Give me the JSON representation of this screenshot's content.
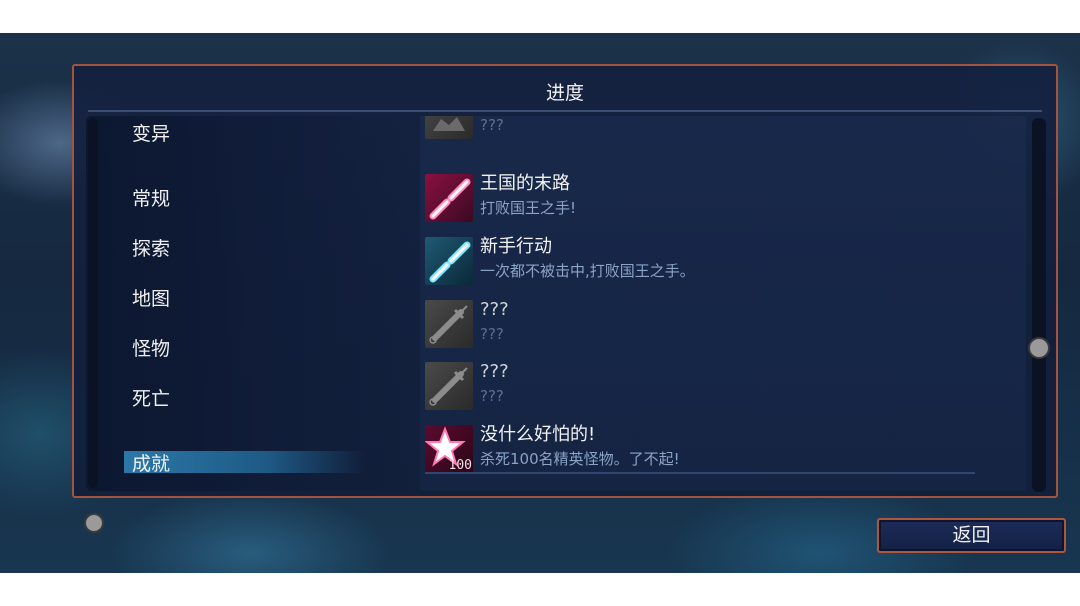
{
  "panel": {
    "title": "进度"
  },
  "categories": [
    {
      "label": "变异",
      "active": false
    },
    {
      "label": "常规",
      "active": false
    },
    {
      "label": "探索",
      "active": false
    },
    {
      "label": "地图",
      "active": false
    },
    {
      "label": "怪物",
      "active": false
    },
    {
      "label": "死亡",
      "active": false
    },
    {
      "label": "成就",
      "active": true
    }
  ],
  "achievements": [
    {
      "name": "",
      "desc": "???",
      "icon": "locked-figure-icon",
      "locked": true
    },
    {
      "name": "王国的末路",
      "desc": "打败国王之手!",
      "icon": "pink-blades-icon",
      "locked": false
    },
    {
      "name": "新手行动",
      "desc": "一次都不被击中,打败国王之手。",
      "icon": "cyan-blades-icon",
      "locked": false
    },
    {
      "name": "???",
      "desc": "???",
      "icon": "syringe-icon",
      "locked": true
    },
    {
      "name": "???",
      "desc": "???",
      "icon": "syringe-icon",
      "locked": true
    },
    {
      "name": "没什么好怕的!",
      "desc": "杀死100名精英怪物。了不起!",
      "icon": "star-icon",
      "icon_badge": "100",
      "locked": false
    }
  ],
  "footer": {
    "back_label": "返回"
  },
  "colors": {
    "accent_border": "#a4533d",
    "panel_bg": "#14213f",
    "active_tab": "#2b78a8",
    "desc_text": "#8aa3c8"
  }
}
